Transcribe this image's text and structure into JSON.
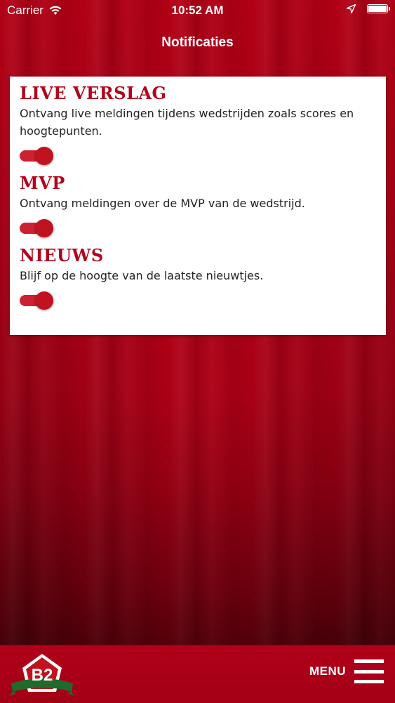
{
  "status_bar": {
    "carrier": "Carrier",
    "time": "10:52 AM",
    "wifi_icon": "wifi-icon",
    "location_icon": "location-arrow-icon",
    "battery_icon": "battery-icon",
    "battery_level": 1.0
  },
  "header": {
    "title": "Notificaties"
  },
  "sections": [
    {
      "title": "LIVE VERSLAG",
      "description": "Ontvang live meldingen tijdens wedstrijden zoals scores en hoogtepunten.",
      "enabled": true
    },
    {
      "title": "MVP",
      "description": "Ontvang meldingen over de MVP van de wedstrijd.",
      "enabled": true
    },
    {
      "title": "NIEUWS",
      "description": "Blijf op de hoogte van de laatste nieuwtjes.",
      "enabled": true
    }
  ],
  "footer": {
    "logo_text": "B2",
    "menu_label": "MENU",
    "menu_icon": "hamburger-menu-icon"
  },
  "colors": {
    "brand_red": "#b0061c",
    "toggle_on": "#c1121f",
    "background": "#a00015"
  }
}
